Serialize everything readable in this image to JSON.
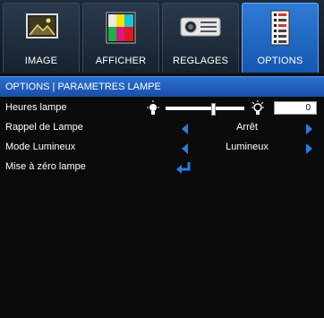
{
  "tabs": [
    {
      "label": "IMAGE",
      "icon": "image-icon",
      "active": false
    },
    {
      "label": "AFFICHER",
      "icon": "display-icon",
      "active": false
    },
    {
      "label": "REGLAGES",
      "icon": "projector-icon",
      "active": false
    },
    {
      "label": "OPTIONS",
      "icon": "options-list-icon",
      "active": true
    }
  ],
  "header": {
    "title": "OPTIONS | PARAMETRES LAMPE"
  },
  "rows": {
    "lamp_hours": {
      "label": "Heures lampe",
      "value": "0",
      "slider_fraction": 0.6
    },
    "lamp_reminder": {
      "label": "Rappel de Lampe",
      "value": "Arrêt"
    },
    "brightness_mode": {
      "label": "Mode Lumineux",
      "value": "Lumineux"
    },
    "lamp_reset": {
      "label": "Mise à zéro lampe"
    }
  },
  "colors": {
    "accent": "#2a7be4",
    "active_tab": "#1f63c3",
    "background": "#0b0b0b"
  }
}
